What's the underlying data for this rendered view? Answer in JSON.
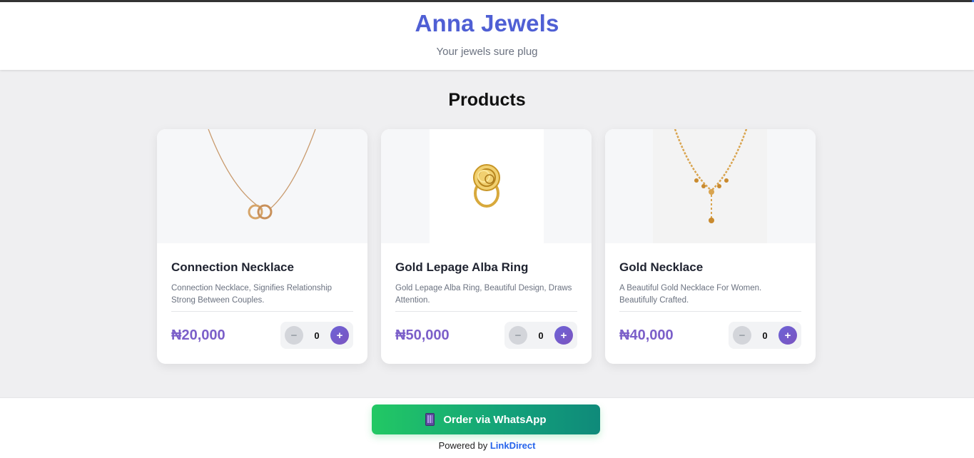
{
  "header": {
    "brand": "Anna Jewels",
    "tagline": "Your jewels sure plug"
  },
  "section": {
    "title": "Products"
  },
  "products": [
    {
      "name": "Connection Necklace",
      "description": "Connection Necklace, Signifies Relationship Strong Between Couples.",
      "price": "₦20,000",
      "quantity": "0",
      "image_icon": "necklace-icon"
    },
    {
      "name": "Gold Lepage Alba Ring",
      "description": "Gold Lepage Alba Ring, Beautiful Design, Draws Attention.",
      "price": "₦50,000",
      "quantity": "0",
      "image_icon": "ring-icon"
    },
    {
      "name": "Gold Necklace",
      "description": "A Beautiful Gold Necklace For Women. Beautifully Crafted.",
      "price": "₦40,000",
      "quantity": "0",
      "image_icon": "necklace-icon"
    }
  ],
  "stepper": {
    "minus": "−",
    "plus": "+"
  },
  "footer": {
    "order_button": "Order via WhatsApp",
    "order_icon": "phone-icon",
    "powered_by": "Powered by",
    "powered_link": "LinkDirect"
  },
  "colors": {
    "brand": "#4f5fd4",
    "price": "#7b5fc9",
    "whatsapp_start": "#22c864",
    "whatsapp_end": "#0f8a7a",
    "link": "#2563eb"
  }
}
